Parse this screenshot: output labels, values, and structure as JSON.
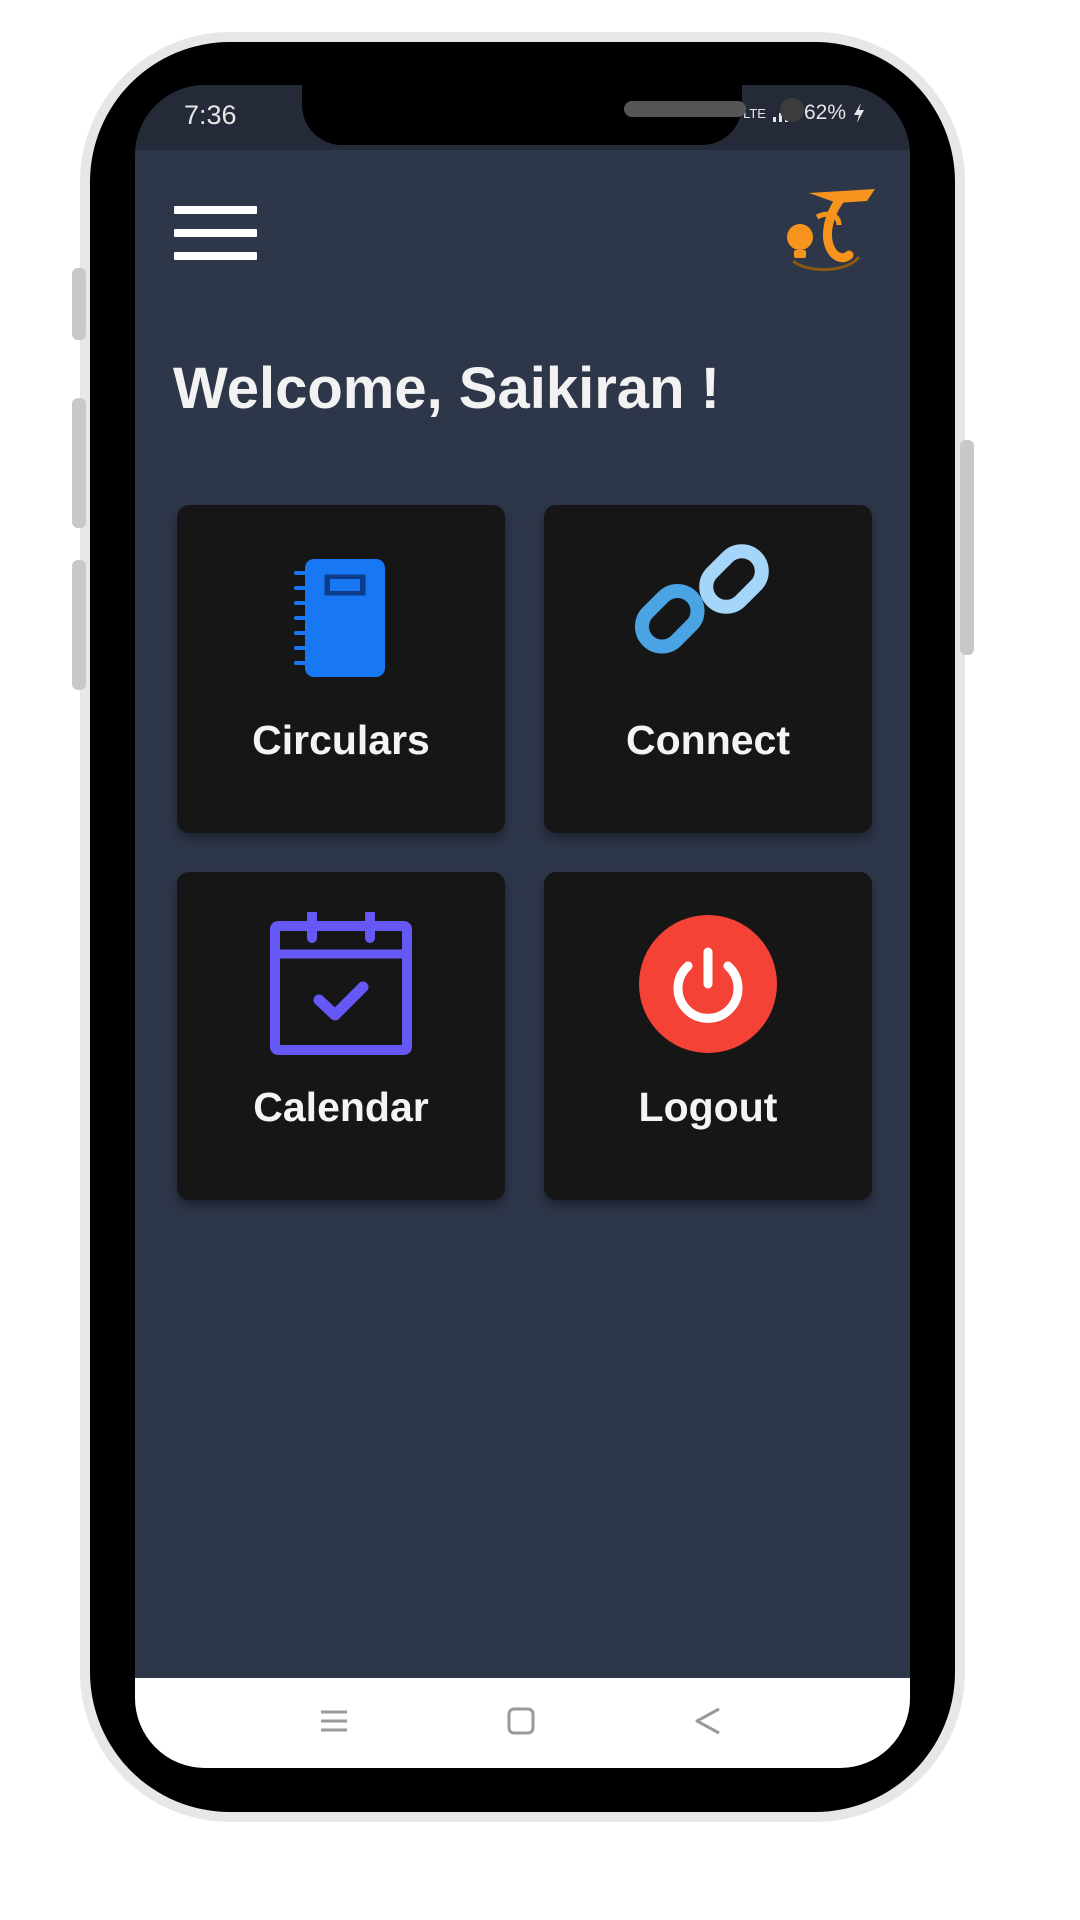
{
  "status_bar": {
    "time": "7:36",
    "network": "LTE",
    "battery": "62%"
  },
  "header": {
    "menu_icon": "hamburger-menu-icon",
    "logo_icon": "app-logo-icon"
  },
  "welcome_text": "Welcome, Saikiran !",
  "tiles": [
    {
      "label": "Circulars",
      "icon": "notebook-icon",
      "color": "#1877f2"
    },
    {
      "label": "Connect",
      "icon": "link-icon",
      "color": "#64b5f6"
    },
    {
      "label": "Calendar",
      "icon": "calendar-check-icon",
      "color": "#6558f5"
    },
    {
      "label": "Logout",
      "icon": "power-icon",
      "color": "#f44336"
    }
  ],
  "nav_bar": {
    "recents_icon": "recents-icon",
    "home_icon": "home-icon",
    "back_icon": "back-icon"
  },
  "colors": {
    "screen_bg": "#2e3649",
    "tile_bg": "#161616",
    "logo_orange": "#f7941d"
  }
}
